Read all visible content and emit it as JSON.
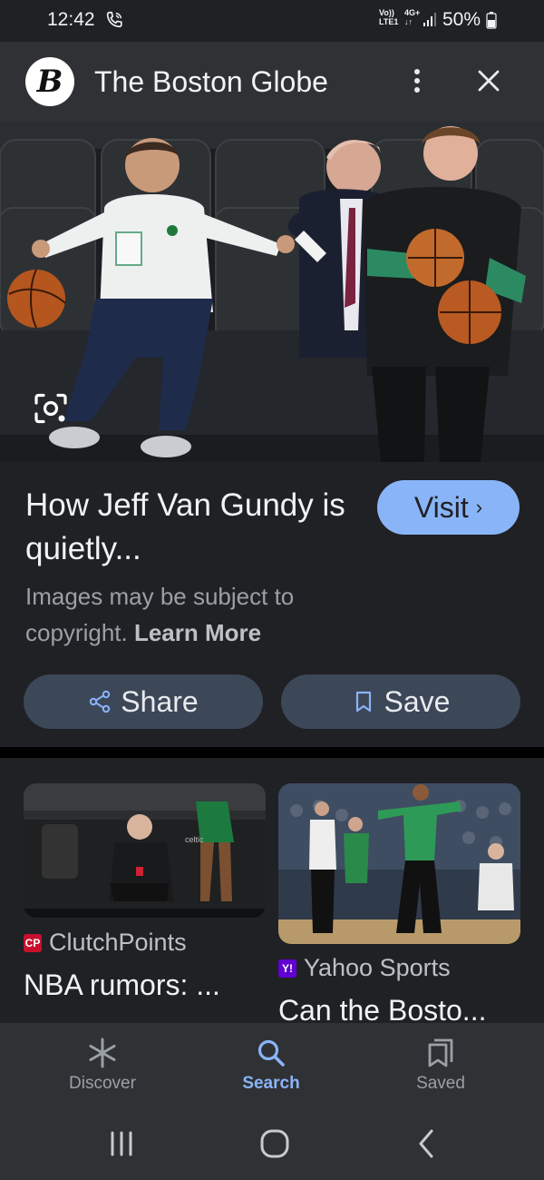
{
  "status_bar": {
    "time": "12:42",
    "network_top": "Vo))",
    "network_bottom": "LTE1",
    "network_gen": "4G+",
    "battery": "50%"
  },
  "header": {
    "logo_letter": "B",
    "title": "The Boston Globe"
  },
  "article": {
    "title": "How Jeff Van Gundy is quietly...",
    "visit_label": "Visit",
    "copyright_text": "Images may be subject to copyright.",
    "learn_more": "Learn More",
    "share_label": "Share",
    "save_label": "Save"
  },
  "related": [
    {
      "source": "ClutchPoints",
      "source_icon_text": "CP",
      "title": "NBA rumors: ..."
    },
    {
      "source": "Yahoo Sports",
      "source_icon_text": "Y!",
      "title": "Can the Bosto..."
    }
  ],
  "bottom_nav": {
    "items": [
      {
        "label": "Discover",
        "icon": "asterisk-icon",
        "active": false
      },
      {
        "label": "Search",
        "icon": "search-icon",
        "active": true
      },
      {
        "label": "Saved",
        "icon": "bookmarks-icon",
        "active": false
      }
    ]
  },
  "colors": {
    "background": "#202124",
    "header": "#303134",
    "accent": "#8ab4f8",
    "pill": "#3c4758"
  }
}
